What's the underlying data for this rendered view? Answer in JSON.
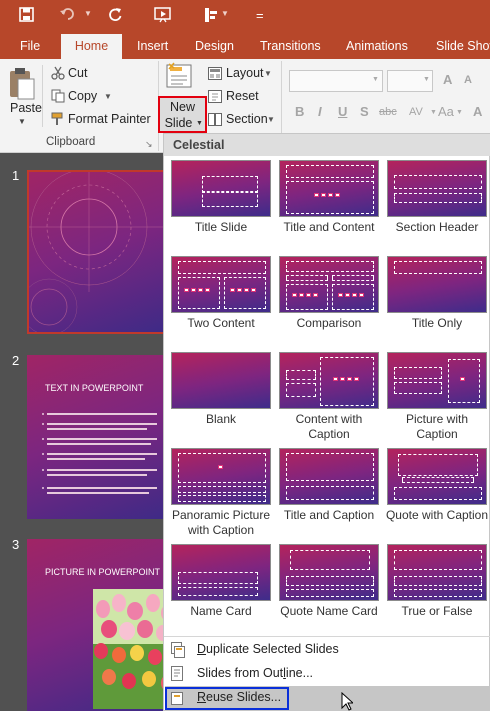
{
  "qat": {
    "more": "="
  },
  "tabs": [
    "File",
    "Home",
    "Insert",
    "Design",
    "Transitions",
    "Animations",
    "Slide Show"
  ],
  "ribbon": {
    "paste": "Paste",
    "cut": "Cut",
    "copy": "Copy",
    "format_painter": "Format Painter",
    "clipboard_group": "Clipboard",
    "new_slide_line1": "New",
    "new_slide_line2": "Slide",
    "layout": "Layout",
    "reset": "Reset",
    "section": "Section",
    "font_b": "B",
    "font_i": "I",
    "font_u": "U",
    "font_s": "S",
    "abc": "abc",
    "av": "AV",
    "aa": "Aa"
  },
  "slides": [
    {
      "number": "1",
      "title": ""
    },
    {
      "number": "2",
      "title": "TEXT IN POWERPOINT"
    },
    {
      "number": "3",
      "title": "PICTURE IN POWERPOINT"
    }
  ],
  "gallery": {
    "theme_name": "Celestial",
    "layouts": [
      "Title Slide",
      "Title and Content",
      "Section Header",
      "Two Content",
      "Comparison",
      "Title Only",
      "Blank",
      "Content with Caption",
      "Picture with Caption",
      "Panoramic Picture with Caption",
      "Title and Caption",
      "Quote with Caption",
      "Name Card",
      "Quote Name Card",
      "True or False"
    ]
  },
  "menu": {
    "duplicate_u": "D",
    "duplicate_rest": "uplicate Selected Slides",
    "outline_pre": "Slides from Out",
    "outline_u": "l",
    "outline_post": "ine...",
    "reuse_u": "R",
    "reuse_rest": "euse Slides..."
  },
  "colors": {
    "accent": "#b7472a",
    "highlight_red": "#e3000f",
    "highlight_blue": "#0a2fd9"
  }
}
